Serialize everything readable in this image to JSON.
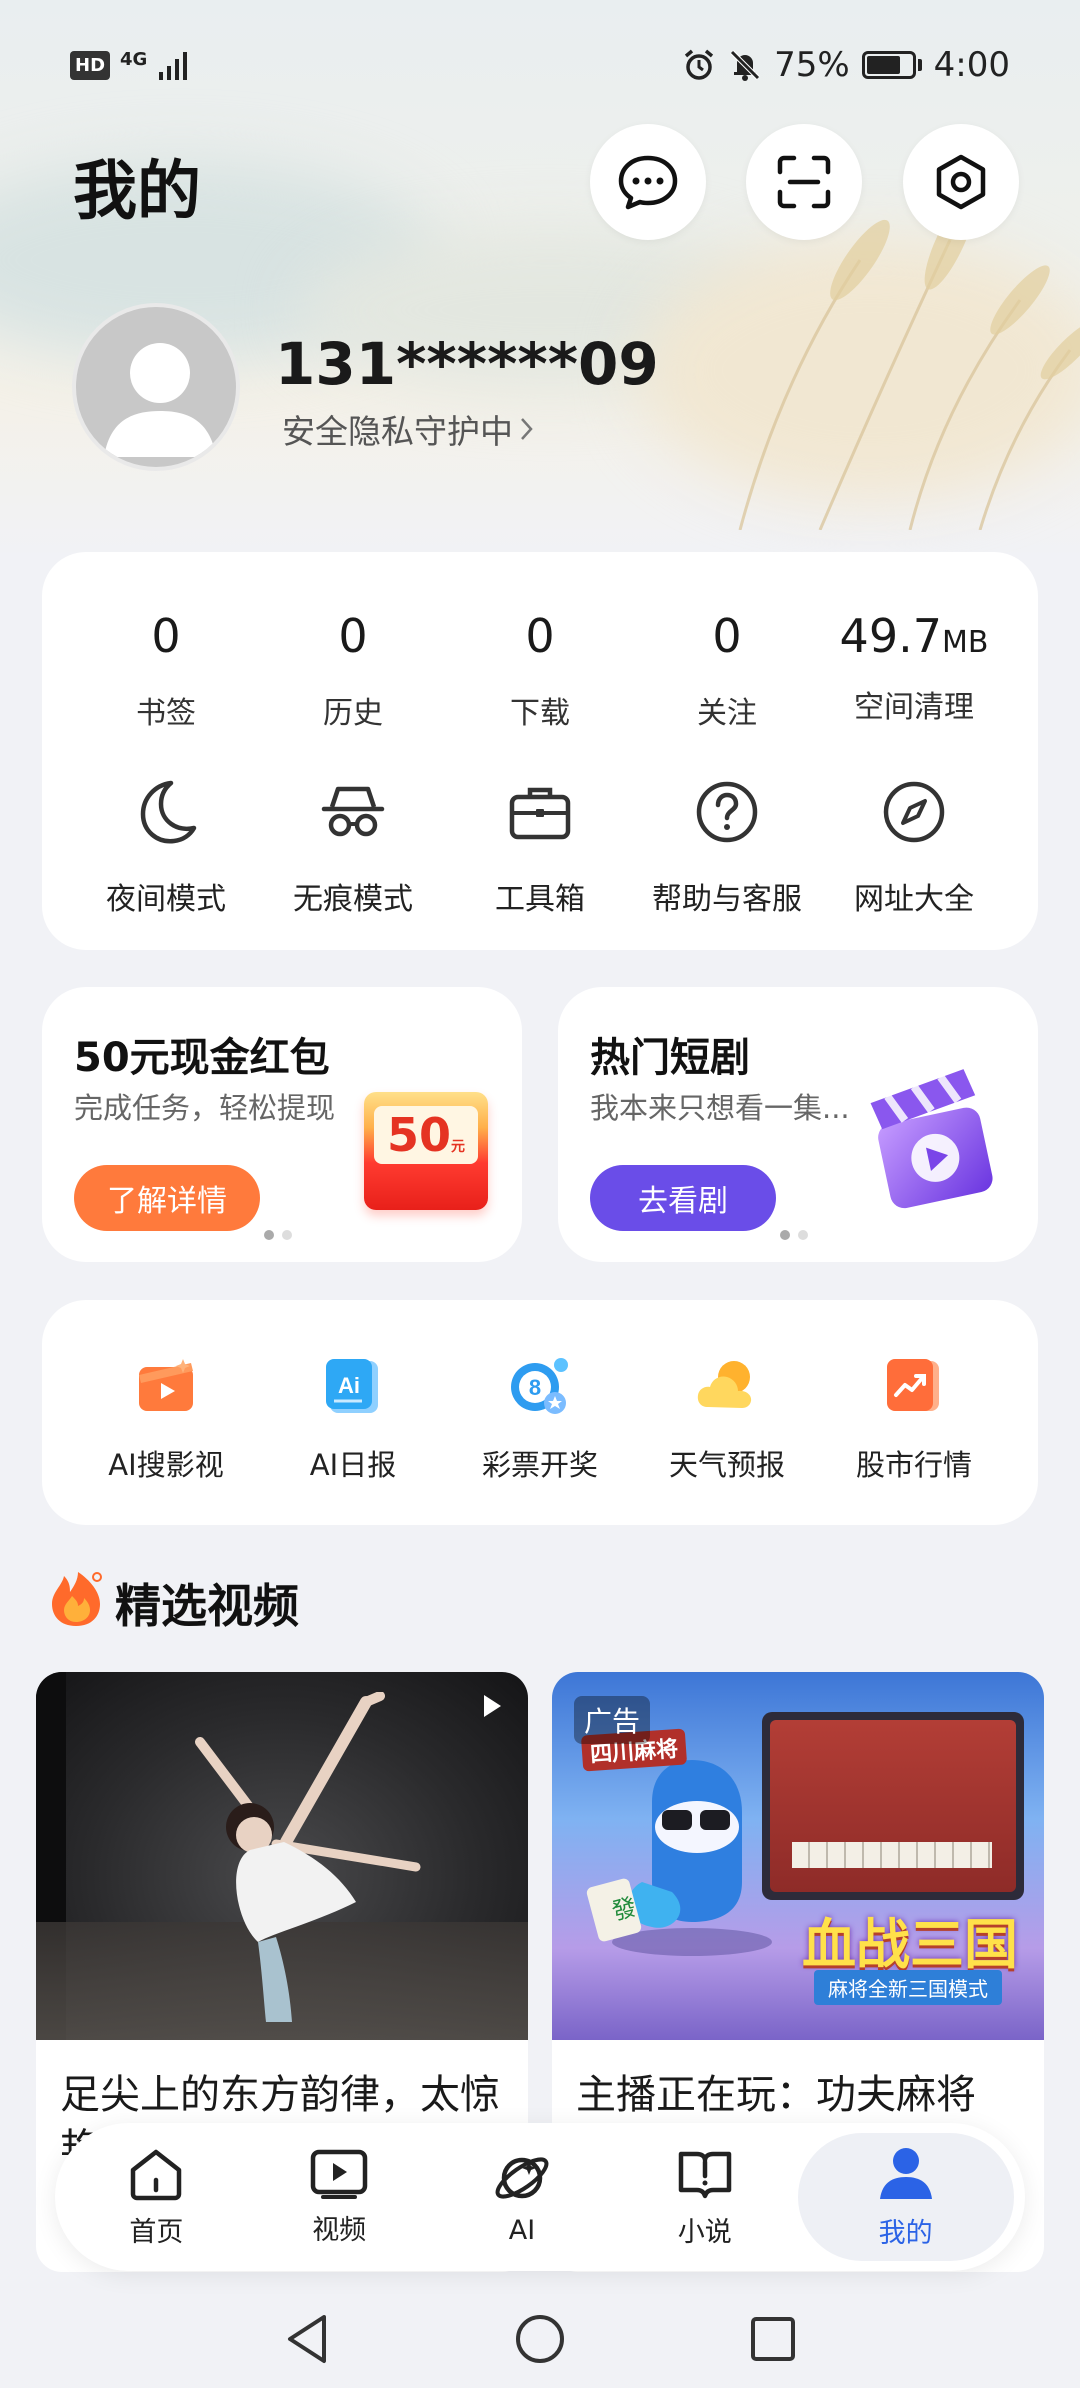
{
  "status_bar": {
    "hd": "HD",
    "network": "4G",
    "battery_percent": "75%",
    "battery_level": 0.75,
    "time": "4:00"
  },
  "header": {
    "title": "我的",
    "icons": [
      "chat-icon",
      "scan-icon",
      "settings-icon"
    ]
  },
  "profile": {
    "username": "131******09",
    "privacy_text": "安全隐私守护中"
  },
  "stats": [
    {
      "value": "0",
      "unit": "",
      "label": "书签"
    },
    {
      "value": "0",
      "unit": "",
      "label": "历史"
    },
    {
      "value": "0",
      "unit": "",
      "label": "下载"
    },
    {
      "value": "0",
      "unit": "",
      "label": "关注"
    },
    {
      "value": "49.7",
      "unit": "MB",
      "label": "空间清理"
    }
  ],
  "tools": [
    {
      "label": "夜间模式",
      "icon": "moon-icon"
    },
    {
      "label": "无痕模式",
      "icon": "incognito-icon"
    },
    {
      "label": "工具箱",
      "icon": "toolbox-icon"
    },
    {
      "label": "帮助与客服",
      "icon": "help-icon"
    },
    {
      "label": "网址大全",
      "icon": "compass-icon"
    }
  ],
  "promos": [
    {
      "title": "50元现金红包",
      "subtitle": "完成任务，轻松提现",
      "button": "了解详情",
      "button_color": "#ff7a3c",
      "badge": "50",
      "badge_unit": "元"
    },
    {
      "title": "热门短剧",
      "subtitle": "我本来只想看一集...",
      "button": "去看剧",
      "button_color": "#6a4de8"
    }
  ],
  "services": [
    {
      "label": "AI搜影视",
      "icon": "ai-video-icon"
    },
    {
      "label": "AI日报",
      "icon": "ai-daily-icon"
    },
    {
      "label": "彩票开奖",
      "icon": "lottery-icon"
    },
    {
      "label": "天气预报",
      "icon": "weather-icon"
    },
    {
      "label": "股市行情",
      "icon": "stock-icon"
    }
  ],
  "section": {
    "title": "精选视频"
  },
  "videos": [
    {
      "title": "足尖上的东方韵律，太惊艳",
      "ad": ""
    },
    {
      "title": "主播正在玩：功夫麻将",
      "ad": "广告",
      "game_title": "血战三国",
      "game_sub": "麻将全新三国模式",
      "game_brand": "四川麻将"
    }
  ],
  "bottom_nav": [
    {
      "label": "首页",
      "icon": "home-icon"
    },
    {
      "label": "视频",
      "icon": "video-icon"
    },
    {
      "label": "AI",
      "icon": "ai-planet-icon"
    },
    {
      "label": "小说",
      "icon": "book-icon"
    },
    {
      "label": "我的",
      "icon": "profile-icon",
      "active": true
    }
  ],
  "accent_color": "#2b63e6"
}
